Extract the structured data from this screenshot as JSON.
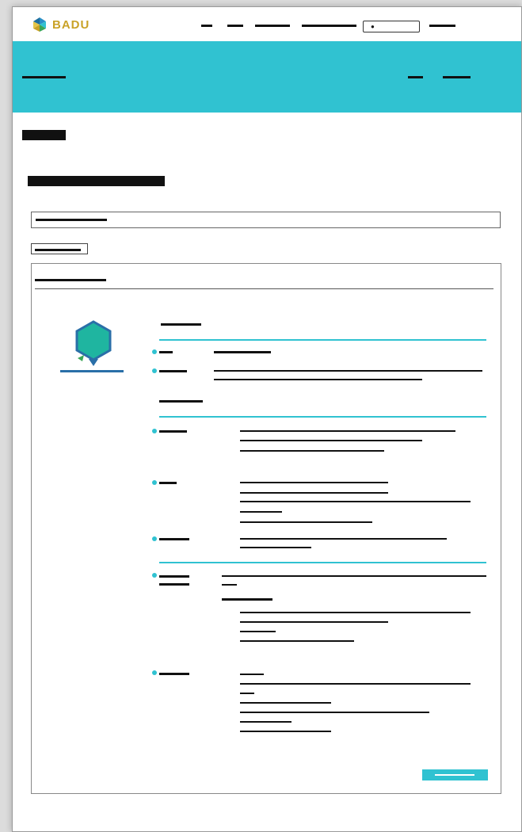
{
  "header": {
    "brand_name": "BADU",
    "colors": {
      "accent": "#30c2d1",
      "brand_gold": "#c9a227",
      "badge_teal": "#1fb5a0",
      "badge_blue": "#2a6fa8"
    },
    "icons": {
      "logo": "badu-logo-icon",
      "user": "person-icon",
      "badge": "hexagon-badge-icon"
    }
  }
}
